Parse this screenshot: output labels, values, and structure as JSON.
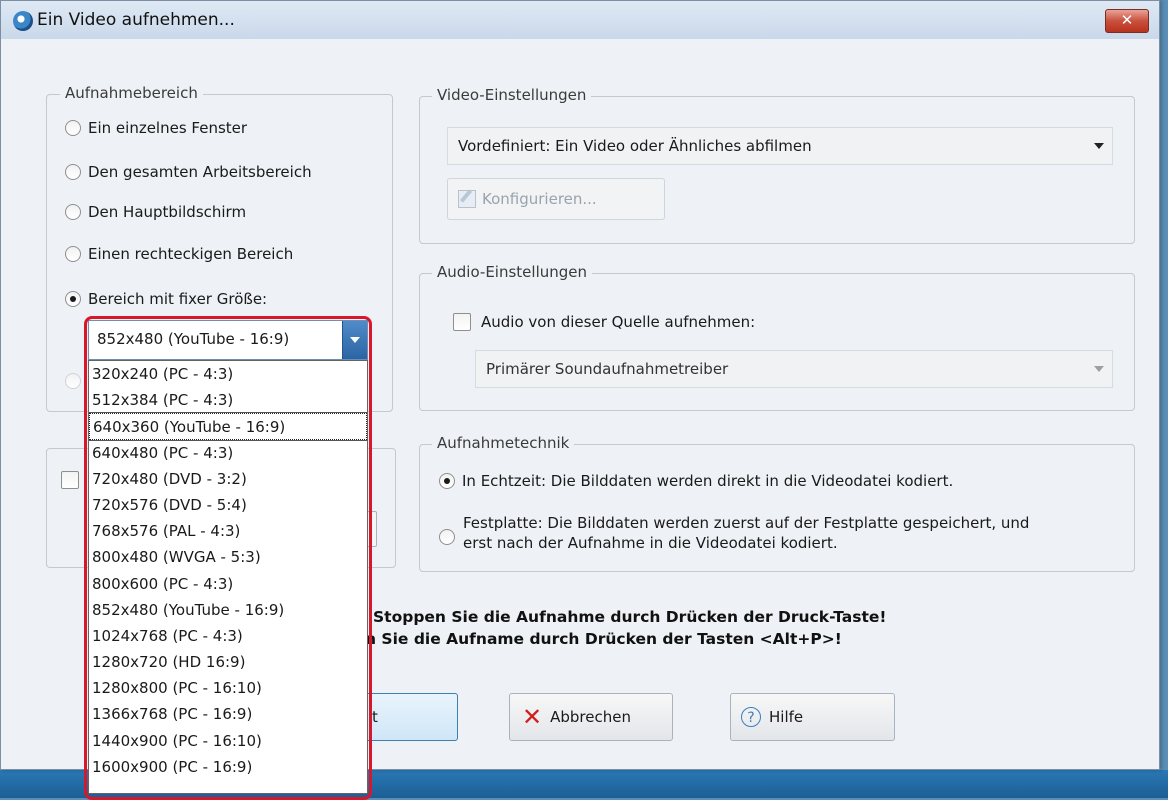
{
  "window": {
    "title": "Ein Video aufnehmen...",
    "close_label": "✕"
  },
  "capture_area": {
    "title": "Aufnahmebereich",
    "options": [
      {
        "label": "Ein einzelnes Fenster",
        "checked": false
      },
      {
        "label": "Den gesamten Arbeitsbereich",
        "checked": false
      },
      {
        "label": "Den Hauptbildschirm",
        "checked": false
      },
      {
        "label": "Einen rechteckigen Bereich",
        "checked": false
      },
      {
        "label": "Bereich mit fixer Größe:",
        "checked": true
      }
    ],
    "fixed_size": {
      "selected": "852x480 (YouTube - 16:9)",
      "options": [
        "320x240 (PC - 4:3)",
        "512x384 (PC - 4:3)",
        "640x360 (YouTube - 16:9)",
        "640x480 (PC - 4:3)",
        "720x480 (DVD - 3:2)",
        "720x576 (DVD - 5:4)",
        "768x576 (PAL - 4:3)",
        "800x480 (WVGA - 5:3)",
        "800x600 (PC - 4:3)",
        "852x480 (YouTube - 16:9)",
        "1024x768 (PC - 4:3)",
        "1280x720 (HD 16:9)",
        "1280x800 (PC - 16:10)",
        "1366x768 (PC - 16:9)",
        "1440x900 (PC - 16:10)",
        "1600x900 (PC - 16:9)"
      ],
      "highlighted_option": "640x360 (YouTube - 16:9)"
    }
  },
  "video_settings": {
    "title": "Video-Einstellungen",
    "preset": "Vordefiniert: Ein Video oder Ähnliches abfilmen",
    "configure_label": "Konfigurieren..."
  },
  "audio_settings": {
    "title": "Audio-Einstellungen",
    "record_label": "Audio von dieser Quelle aufnehmen:",
    "record_checked": false,
    "source": "Primärer Soundaufnahmetreiber"
  },
  "capture_technique": {
    "title": "Aufnahmetechnik",
    "options": [
      {
        "label": "In Echtzeit: Die Bilddaten werden direkt in die Videodatei kodiert.",
        "checked": true
      },
      {
        "label_line1": "Festplatte: Die Bilddaten werden zuerst auf der Festplatte gespeichert, und",
        "label_line2": "erst nach der Aufnahme in die Videodatei kodiert.",
        "checked": false
      }
    ]
  },
  "messages": {
    "line1": "Stoppen Sie die Aufnahme durch Drücken der Druck-Taste!",
    "line2": "n Sie die Aufname durch Drücken der Tasten <Alt+P>!"
  },
  "buttons": {
    "ok_fragment": "t",
    "cancel": "Abbrechen",
    "help": "Hilfe"
  }
}
